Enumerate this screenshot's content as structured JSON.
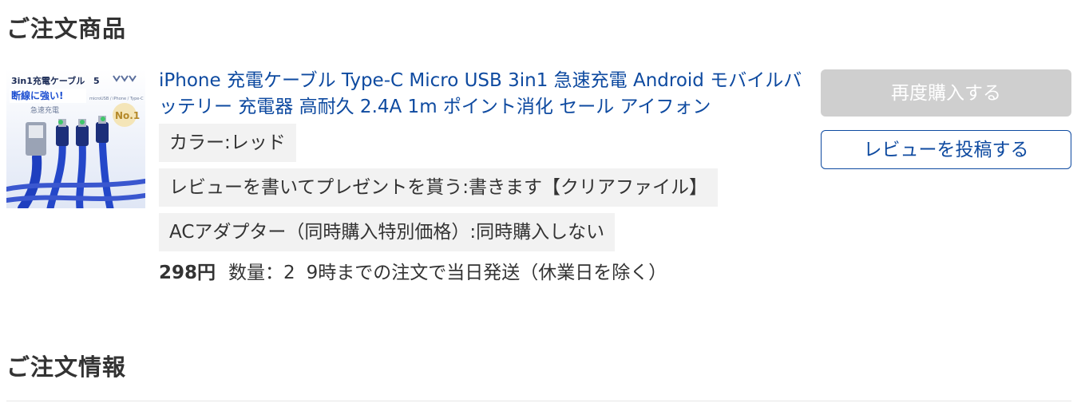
{
  "sections": {
    "products_title": "ご注文商品",
    "info_title": "ご注文情報"
  },
  "product": {
    "thumbnail": {
      "headline": "3in1充電ケーブル",
      "tagline": "断線に強い!",
      "subtitle": "急速充電",
      "spec": "microUSB / iPhone / Type-C",
      "badge_number": "5",
      "badge_rank": "No.1"
    },
    "name": "iPhone 充電ケーブル Type-C Micro USB 3in1 急速充電 Android モバイルバッテリー 充電器 高耐久 2.4A 1m ポイント消化 セール アイフォン",
    "options": [
      "カラー:レッド",
      "レビューを書いてプレゼントを貰う:書きます【クリアファイル】",
      "ACアダプター（同時購入特別価格）:同時購入しない"
    ],
    "price": "298円",
    "quantity": "数量：2",
    "shipping_note": "9時までの注文で当日発送（休業日を除く）"
  },
  "actions": {
    "rebuy_label": "再度購入する",
    "review_label": "レビューを投稿する"
  },
  "colors": {
    "link": "#0e4aa0",
    "disabled_button": "#cfcfcf",
    "option_background": "#f2f2f2"
  }
}
